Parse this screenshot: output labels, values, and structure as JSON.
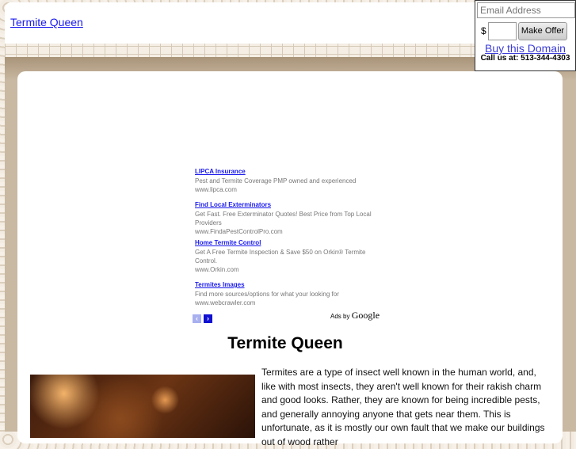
{
  "header": {
    "site_title": "Termite Queen"
  },
  "offer": {
    "email_placeholder": "Email Address",
    "currency": "$",
    "amount_value": "",
    "make_offer": "Make Offer",
    "buy_link": "Buy this Domain",
    "call": "Call us at: 513-344-4303"
  },
  "ads": [
    {
      "title": "LIPCA Insurance",
      "desc": "Pest and Termite Coverage PMP owned and experienced",
      "url": "www.lipca.com"
    },
    {
      "title": "Find Local Exterminators",
      "desc": "Get Fast. Free Exterminator Quotes! Best Price from Top Local Providers",
      "url": "www.FindaPestControlPro.com"
    },
    {
      "title": "Home Termite Control",
      "desc": "Get A Free Termite Inspection & Save $50 on Orkin® Termite Control.",
      "url": "www.Orkin.com"
    },
    {
      "title": "Termites Images",
      "desc": "Find more sources/options for what your looking for",
      "url": "www.webcrawler.com"
    }
  ],
  "ads_nav": {
    "prev": "‹",
    "next": "›"
  },
  "ads_by": {
    "prefix": "Ads by",
    "brand": "Google"
  },
  "main": {
    "heading": "Termite Queen",
    "paragraph": "Termites are a type of insect well known in the human world, and, like with most insects, they aren't well known for their rakish charm and good looks.  Rather, they are known for being incredible pests, and generally annoying anyone that gets near them.  This is unfortunate, as it is mostly our own fault that we make our buildings out of wood rather"
  }
}
